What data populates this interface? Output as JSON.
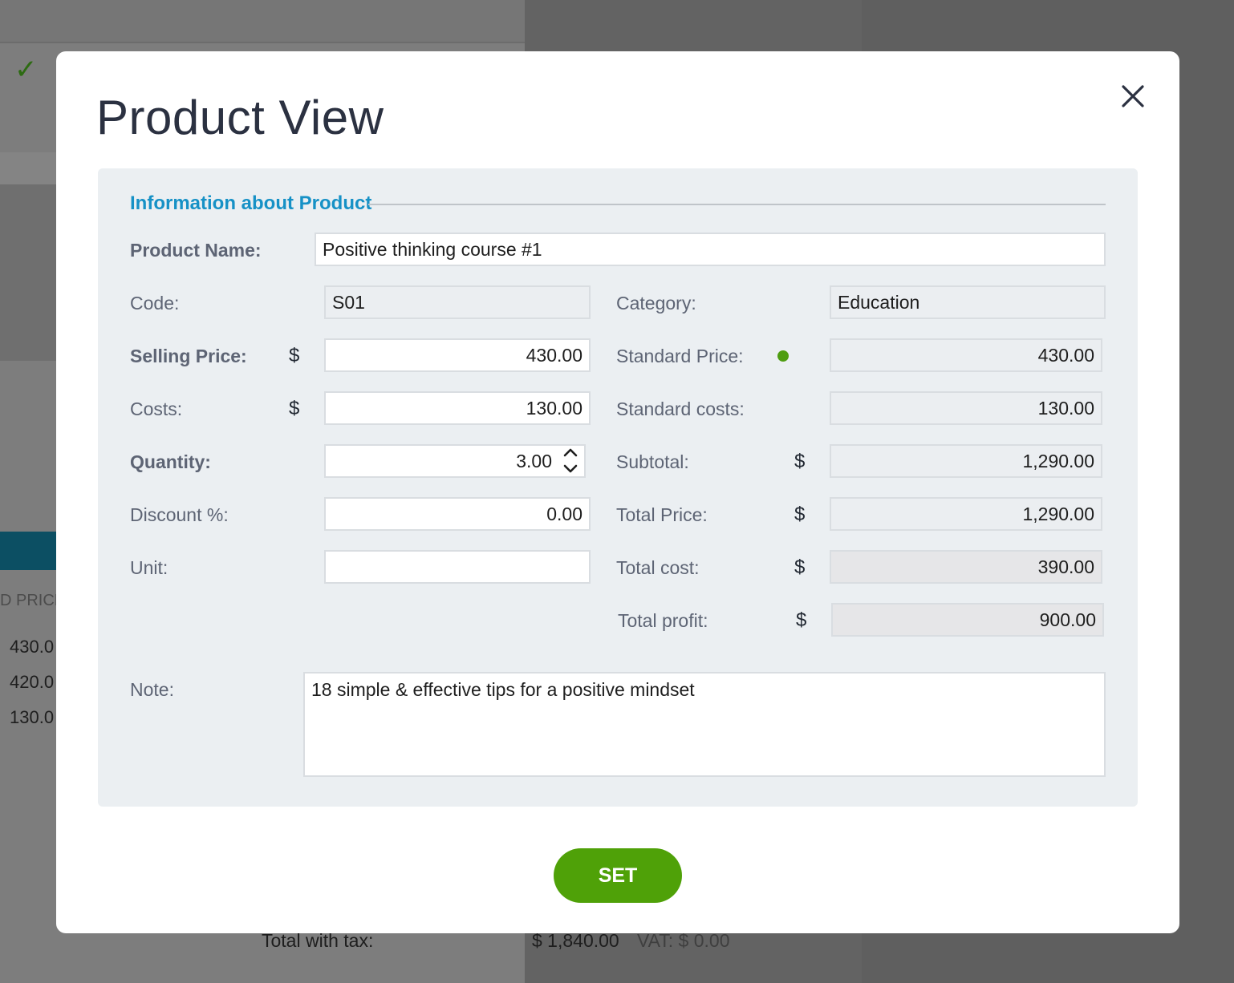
{
  "background": {
    "column_header": "D PRICE",
    "rows": [
      "430.0",
      "420.0",
      "130.0"
    ],
    "total_label": "Total with tax:",
    "total_value": "$ 1,840.00",
    "vat": "VAT: $ 0.00"
  },
  "modal": {
    "title": "Product View",
    "section_title": "Information about Product",
    "product_name": {
      "label": "Product Name:",
      "value": "Positive thinking course #1"
    },
    "code": {
      "label": "Code:",
      "value": "S01"
    },
    "category": {
      "label": "Category:",
      "value": "Education"
    },
    "selling_price": {
      "label": "Selling Price:",
      "currency": "$",
      "value": "430.00"
    },
    "standard_price": {
      "label": "Standard Price:",
      "value": "430.00",
      "status_color": "#4e9d11"
    },
    "costs": {
      "label": "Costs:",
      "currency": "$",
      "value": "130.00"
    },
    "standard_costs": {
      "label": "Standard costs:",
      "value": "130.00"
    },
    "quantity": {
      "label": "Quantity:",
      "value": "3.00"
    },
    "subtotal": {
      "label": "Subtotal:",
      "currency": "$",
      "value": "1,290.00"
    },
    "discount": {
      "label": "Discount %:",
      "value": "0.00"
    },
    "total_price": {
      "label": "Total Price:",
      "currency": "$",
      "value": "1,290.00"
    },
    "unit": {
      "label": "Unit:",
      "value": ""
    },
    "total_cost": {
      "label": "Total cost:",
      "currency": "$",
      "value": "390.00"
    },
    "total_profit": {
      "label": "Total profit:",
      "currency": "$",
      "value": "900.00"
    },
    "note": {
      "label": "Note:",
      "value": "18 simple & effective tips for a positive mindset"
    },
    "set_button": "SET",
    "icons": {
      "close": "close-icon",
      "spinner_up": "chevron-up-icon",
      "spinner_down": "chevron-down-icon",
      "background_check": "check-icon"
    },
    "colors": {
      "accent": "#1691c6",
      "button": "#4fa108"
    }
  }
}
